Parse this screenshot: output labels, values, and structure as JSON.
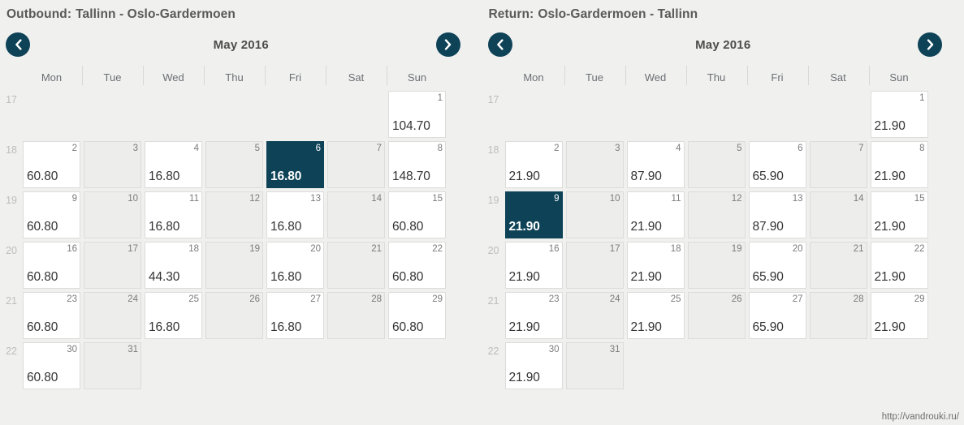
{
  "theme": {
    "background": "#f0f0ef",
    "accent": "#0d4257",
    "cell_empty": "#ededec",
    "cell_priced": "#ffffff",
    "cell_border": "#dcdcda",
    "text": "#4a4a4a"
  },
  "weekday_labels": [
    "Mon",
    "Tue",
    "Wed",
    "Thu",
    "Fri",
    "Sat",
    "Sun"
  ],
  "footer": {
    "watermark": "http://vandrouki.ru/"
  },
  "panels": [
    {
      "label": "Outbound:",
      "route": "Tallinn - Oslo-Gardermoen",
      "month": "May 2016",
      "prev_label": "‹",
      "next_label": "›",
      "weeks": [
        {
          "number": "17",
          "days": [
            {
              "day": "",
              "price": "",
              "state": "blank"
            },
            {
              "day": "",
              "price": "",
              "state": "blank"
            },
            {
              "day": "",
              "price": "",
              "state": "blank"
            },
            {
              "day": "",
              "price": "",
              "state": "blank"
            },
            {
              "day": "",
              "price": "",
              "state": "blank"
            },
            {
              "day": "",
              "price": "",
              "state": "blank"
            },
            {
              "day": "1",
              "price": "104.70",
              "state": "priced"
            }
          ]
        },
        {
          "number": "18",
          "days": [
            {
              "day": "2",
              "price": "60.80",
              "state": "priced"
            },
            {
              "day": "3",
              "price": "",
              "state": "empty"
            },
            {
              "day": "4",
              "price": "16.80",
              "state": "priced"
            },
            {
              "day": "5",
              "price": "",
              "state": "empty"
            },
            {
              "day": "6",
              "price": "16.80",
              "state": "selected"
            },
            {
              "day": "7",
              "price": "",
              "state": "empty"
            },
            {
              "day": "8",
              "price": "148.70",
              "state": "priced"
            }
          ]
        },
        {
          "number": "19",
          "days": [
            {
              "day": "9",
              "price": "60.80",
              "state": "priced"
            },
            {
              "day": "10",
              "price": "",
              "state": "empty"
            },
            {
              "day": "11",
              "price": "16.80",
              "state": "priced"
            },
            {
              "day": "12",
              "price": "",
              "state": "empty"
            },
            {
              "day": "13",
              "price": "16.80",
              "state": "priced"
            },
            {
              "day": "14",
              "price": "",
              "state": "empty"
            },
            {
              "day": "15",
              "price": "60.80",
              "state": "priced"
            }
          ]
        },
        {
          "number": "20",
          "days": [
            {
              "day": "16",
              "price": "60.80",
              "state": "priced"
            },
            {
              "day": "17",
              "price": "",
              "state": "empty"
            },
            {
              "day": "18",
              "price": "44.30",
              "state": "priced"
            },
            {
              "day": "19",
              "price": "",
              "state": "empty"
            },
            {
              "day": "20",
              "price": "16.80",
              "state": "priced"
            },
            {
              "day": "21",
              "price": "",
              "state": "empty"
            },
            {
              "day": "22",
              "price": "60.80",
              "state": "priced"
            }
          ]
        },
        {
          "number": "21",
          "days": [
            {
              "day": "23",
              "price": "60.80",
              "state": "priced"
            },
            {
              "day": "24",
              "price": "",
              "state": "empty"
            },
            {
              "day": "25",
              "price": "16.80",
              "state": "priced"
            },
            {
              "day": "26",
              "price": "",
              "state": "empty"
            },
            {
              "day": "27",
              "price": "16.80",
              "state": "priced"
            },
            {
              "day": "28",
              "price": "",
              "state": "empty"
            },
            {
              "day": "29",
              "price": "60.80",
              "state": "priced"
            }
          ]
        },
        {
          "number": "22",
          "days": [
            {
              "day": "30",
              "price": "60.80",
              "state": "priced"
            },
            {
              "day": "31",
              "price": "",
              "state": "empty"
            },
            {
              "day": "",
              "price": "",
              "state": "blank"
            },
            {
              "day": "",
              "price": "",
              "state": "blank"
            },
            {
              "day": "",
              "price": "",
              "state": "blank"
            },
            {
              "day": "",
              "price": "",
              "state": "blank"
            },
            {
              "day": "",
              "price": "",
              "state": "blank"
            }
          ]
        }
      ]
    },
    {
      "label": "Return:",
      "route": "Oslo-Gardermoen - Tallinn",
      "month": "May 2016",
      "prev_label": "‹",
      "next_label": "›",
      "weeks": [
        {
          "number": "17",
          "days": [
            {
              "day": "",
              "price": "",
              "state": "blank"
            },
            {
              "day": "",
              "price": "",
              "state": "blank"
            },
            {
              "day": "",
              "price": "",
              "state": "blank"
            },
            {
              "day": "",
              "price": "",
              "state": "blank"
            },
            {
              "day": "",
              "price": "",
              "state": "blank"
            },
            {
              "day": "",
              "price": "",
              "state": "blank"
            },
            {
              "day": "1",
              "price": "21.90",
              "state": "priced"
            }
          ]
        },
        {
          "number": "18",
          "days": [
            {
              "day": "2",
              "price": "21.90",
              "state": "priced"
            },
            {
              "day": "3",
              "price": "",
              "state": "empty"
            },
            {
              "day": "4",
              "price": "87.90",
              "state": "priced"
            },
            {
              "day": "5",
              "price": "",
              "state": "empty"
            },
            {
              "day": "6",
              "price": "65.90",
              "state": "priced"
            },
            {
              "day": "7",
              "price": "",
              "state": "empty"
            },
            {
              "day": "8",
              "price": "21.90",
              "state": "priced"
            }
          ]
        },
        {
          "number": "19",
          "days": [
            {
              "day": "9",
              "price": "21.90",
              "state": "selected"
            },
            {
              "day": "10",
              "price": "",
              "state": "empty"
            },
            {
              "day": "11",
              "price": "21.90",
              "state": "priced"
            },
            {
              "day": "12",
              "price": "",
              "state": "empty"
            },
            {
              "day": "13",
              "price": "87.90",
              "state": "priced"
            },
            {
              "day": "14",
              "price": "",
              "state": "empty"
            },
            {
              "day": "15",
              "price": "21.90",
              "state": "priced"
            }
          ]
        },
        {
          "number": "20",
          "days": [
            {
              "day": "16",
              "price": "21.90",
              "state": "priced"
            },
            {
              "day": "17",
              "price": "",
              "state": "empty"
            },
            {
              "day": "18",
              "price": "21.90",
              "state": "priced"
            },
            {
              "day": "19",
              "price": "",
              "state": "empty"
            },
            {
              "day": "20",
              "price": "65.90",
              "state": "priced"
            },
            {
              "day": "21",
              "price": "",
              "state": "empty"
            },
            {
              "day": "22",
              "price": "21.90",
              "state": "priced"
            }
          ]
        },
        {
          "number": "21",
          "days": [
            {
              "day": "23",
              "price": "21.90",
              "state": "priced"
            },
            {
              "day": "24",
              "price": "",
              "state": "empty"
            },
            {
              "day": "25",
              "price": "21.90",
              "state": "priced"
            },
            {
              "day": "26",
              "price": "",
              "state": "empty"
            },
            {
              "day": "27",
              "price": "65.90",
              "state": "priced"
            },
            {
              "day": "28",
              "price": "",
              "state": "empty"
            },
            {
              "day": "29",
              "price": "21.90",
              "state": "priced"
            }
          ]
        },
        {
          "number": "22",
          "days": [
            {
              "day": "30",
              "price": "21.90",
              "state": "priced"
            },
            {
              "day": "31",
              "price": "",
              "state": "empty"
            },
            {
              "day": "",
              "price": "",
              "state": "blank"
            },
            {
              "day": "",
              "price": "",
              "state": "blank"
            },
            {
              "day": "",
              "price": "",
              "state": "blank"
            },
            {
              "day": "",
              "price": "",
              "state": "blank"
            },
            {
              "day": "",
              "price": "",
              "state": "blank"
            }
          ]
        }
      ]
    }
  ]
}
